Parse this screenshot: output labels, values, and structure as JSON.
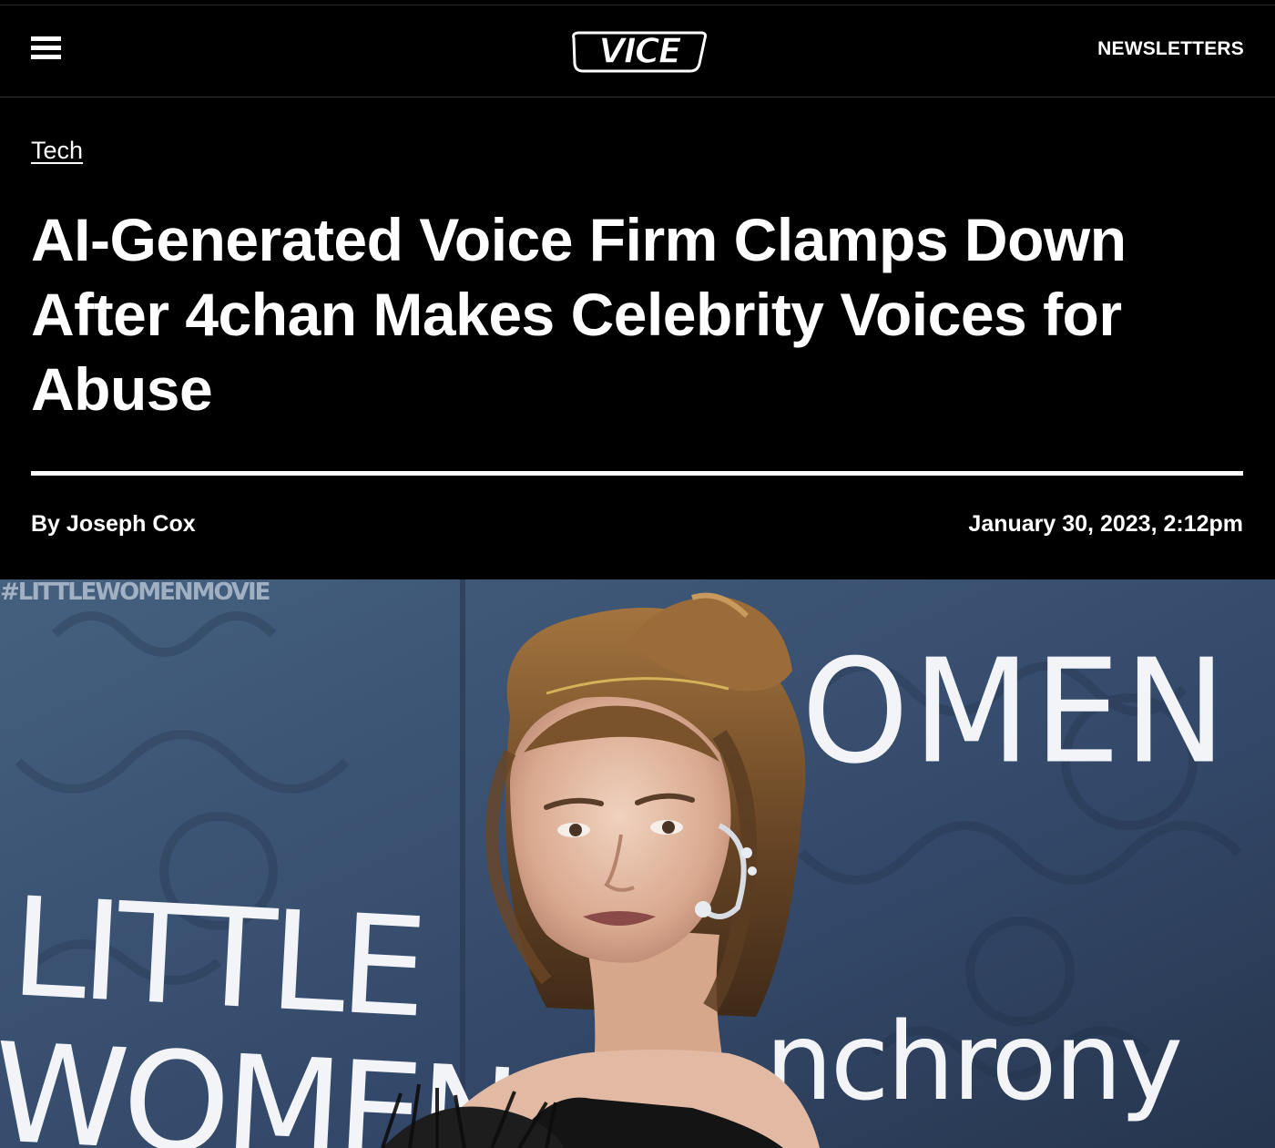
{
  "header": {
    "menu_label": "Menu",
    "logo_text": "VICE",
    "newsletters_label": "NEWSLETTERS"
  },
  "article": {
    "category": "Tech",
    "title": "AI-Generated Voice Firm Clamps Down After 4chan Makes Celebrity Voices for Abuse",
    "byline_prefix": "By",
    "author": "Joseph Cox",
    "date": "January 30, 2023, 2:12pm"
  },
  "hero": {
    "backdrop_text_left_line1": "LITTLE",
    "backdrop_text_left_line2": "WOMEN",
    "backdrop_text_right": "OMEN",
    "backdrop_sponsor": "nchrony",
    "backdrop_top_strip": "#LITTLEWOMENMOVIE",
    "colors": {
      "backdrop": "#3b5170",
      "backdrop_dark": "#2a3b55"
    }
  }
}
